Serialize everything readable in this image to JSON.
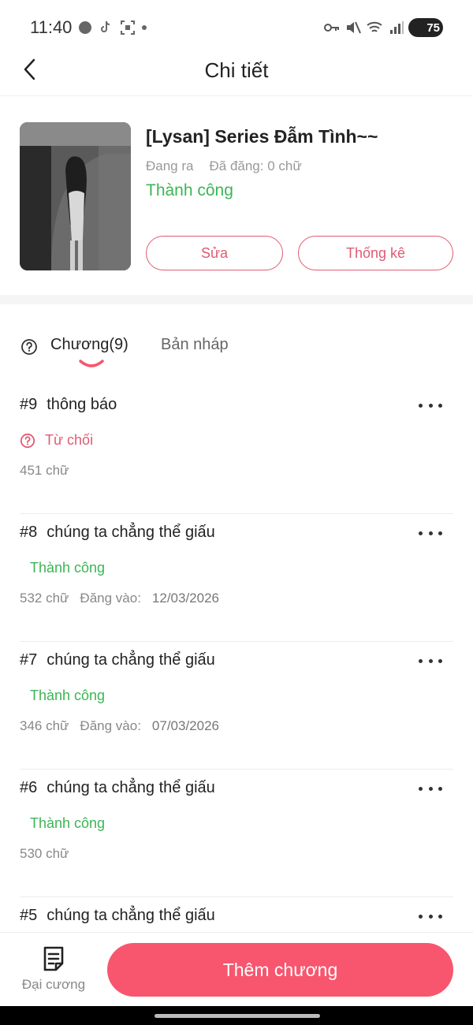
{
  "status_bar": {
    "time": "11:40",
    "battery": "75"
  },
  "header": {
    "title": "Chi tiết"
  },
  "book": {
    "title": "[Lysan] Series Đẫm Tình~~",
    "state": "Đang ra",
    "posted": "Đã đăng: 0 chữ",
    "status": "Thành công",
    "edit_label": "Sửa",
    "stats_label": "Thống kê"
  },
  "tabs": {
    "chapters": "Chương(9)",
    "drafts": "Bản nháp"
  },
  "chapters": [
    {
      "num": "#9",
      "title": "thông báo",
      "status": "Từ chối",
      "words": "451 chữ",
      "posted_label": "",
      "date": ""
    },
    {
      "num": "#8",
      "title": "chúng ta chẳng thể giấu",
      "status": "Thành công",
      "words": "532 chữ",
      "posted_label": "Đăng vào:",
      "date": "12/03/2026"
    },
    {
      "num": "#7",
      "title": "chúng ta chẳng thể giấu",
      "status": "Thành công",
      "words": "346 chữ",
      "posted_label": "Đăng vào:",
      "date": "07/03/2026"
    },
    {
      "num": "#6",
      "title": "chúng ta chẳng thể giấu",
      "status": "Thành công",
      "words": "530 chữ",
      "posted_label": "",
      "date": ""
    },
    {
      "num": "#5",
      "title": "chúng ta chẳng thể giấu"
    }
  ],
  "bottom": {
    "outline_label": "Đại cương",
    "add_chapter_label": "Thêm chương"
  },
  "colors": {
    "accent": "#f7566e",
    "success": "#3cb554",
    "reject": "#e05b72"
  }
}
